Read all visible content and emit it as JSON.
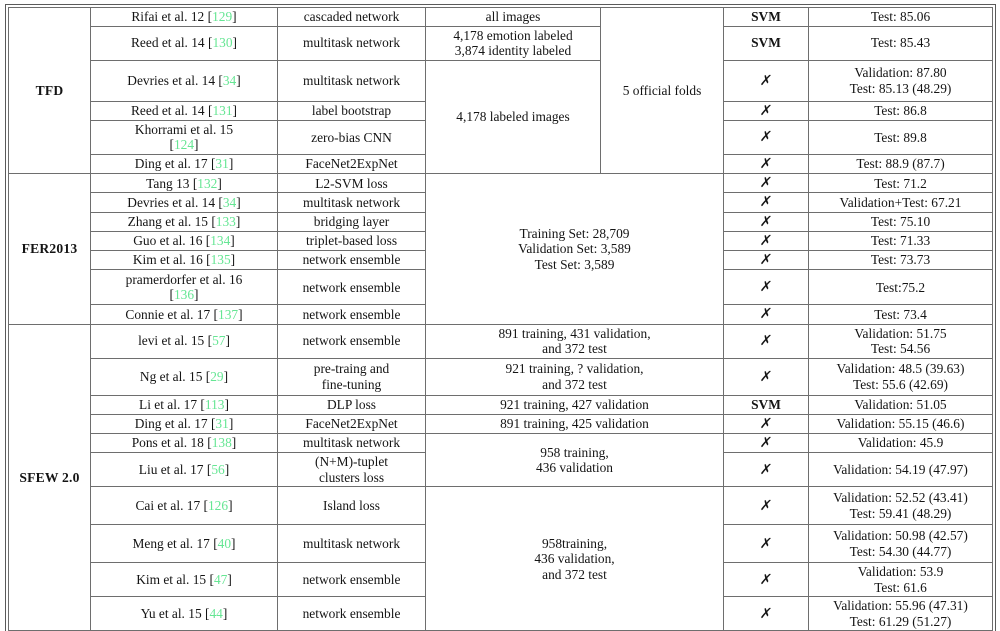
{
  "table": {
    "reference_color": "#66e694",
    "grid_color": "#6e6e6e",
    "text_color": "#141414",
    "cross_glyph": "✗",
    "sections": [
      {
        "dataset": "TFD",
        "rows": [
          {
            "method": "Rifai et al. 12",
            "ref": "129",
            "network": "cascaded network",
            "data": "all images",
            "protocol": "5 official folds",
            "classifier": "SVM",
            "performance": [
              "Test: 85.06"
            ]
          },
          {
            "method": "Reed et al. 14",
            "ref": "130",
            "network": "multitask network",
            "data": "4,178 emotion labeled\n3,874 identity labeled",
            "data_lines": [
              "4,178 emotion labeled",
              "3,874 identity labeled"
            ],
            "classifier": "SVM",
            "performance": [
              "Test: 85.43"
            ]
          },
          {
            "method": "Devries et al. 14",
            "ref": "34",
            "network": "multitask network",
            "classifier": "✗",
            "performance": [
              "Validation: 87.80",
              "Test: 85.13 (48.29)"
            ]
          },
          {
            "method": "Reed et al. 14",
            "ref": "131",
            "network": "label bootstrap",
            "data": "4,178 labeled images",
            "classifier": "✗",
            "performance": [
              "Test: 86.8"
            ]
          },
          {
            "method": "Khorrami et al. 15",
            "ref": "124",
            "method_two_line": true,
            "network": "zero-bias CNN",
            "classifier": "✗",
            "performance": [
              "Test: 89.8"
            ]
          },
          {
            "method": "Ding et al. 17",
            "ref": "31",
            "network": "FaceNet2ExpNet",
            "classifier": "✗",
            "performance": [
              "Test: 88.9 (87.7)"
            ]
          }
        ],
        "merged": {
          "data_all_images": "all images",
          "data_emotion": [
            "4,178 emotion labeled",
            "3,874 identity labeled"
          ],
          "data_labeled": "4,178 labeled images",
          "protocol": "5 official folds"
        }
      },
      {
        "dataset": "FER2013",
        "merged_data": [
          "Training Set: 28,709",
          "Validation Set: 3,589",
          "Test Set: 3,589"
        ],
        "rows": [
          {
            "method": "Tang 13",
            "ref": "132",
            "network": "L2-SVM loss",
            "classifier": "✗",
            "performance": [
              "Test: 71.2"
            ]
          },
          {
            "method": "Devries et al. 14",
            "ref": "34",
            "network": "multitask network",
            "classifier": "✗",
            "performance": [
              "Validation+Test: 67.21"
            ]
          },
          {
            "method": "Zhang et al. 15",
            "ref": "133",
            "network": "bridging layer",
            "classifier": "✗",
            "performance": [
              "Test: 75.10"
            ]
          },
          {
            "method": "Guo et al. 16",
            "ref": "134",
            "network": "triplet-based loss",
            "classifier": "✗",
            "performance": [
              "Test: 71.33"
            ]
          },
          {
            "method": "Kim et al. 16",
            "ref": "135",
            "network": "network ensemble",
            "classifier": "✗",
            "performance": [
              "Test: 73.73"
            ]
          },
          {
            "method": "pramerdorfer et al. 16",
            "ref": "136",
            "method_two_line": true,
            "network": "network ensemble",
            "classifier": "✗",
            "performance": [
              "Test:75.2"
            ]
          },
          {
            "method": "Connie et al. 17",
            "ref": "137",
            "network": "network ensemble",
            "classifier": "✗",
            "performance": [
              "Test: 73.4"
            ]
          }
        ]
      },
      {
        "dataset": "SFEW 2.0",
        "rows": [
          {
            "method": "levi et al. 15",
            "ref": "57",
            "network": "network ensemble",
            "data": [
              "891 training, 431 validation,",
              "and 372 test"
            ],
            "classifier": "✗",
            "performance": [
              "Validation: 51.75",
              "Test: 54.56"
            ]
          },
          {
            "method": "Ng et al. 15",
            "ref": "29",
            "network": [
              "pre-traing and",
              "fine-tuning"
            ],
            "data": [
              "921 training, ? validation,",
              "and 372 test"
            ],
            "classifier": "✗",
            "performance": [
              "Validation: 48.5 (39.63)",
              "Test: 55.6 (42.69)"
            ]
          },
          {
            "method": "Li et al. 17",
            "ref": "113",
            "network": "DLP loss",
            "data": [
              "921 training, 427 validation"
            ],
            "classifier": "SVM",
            "performance": [
              "Validation: 51.05"
            ]
          },
          {
            "method": "Ding et al. 17",
            "ref": "31",
            "network": "FaceNet2ExpNet",
            "data": [
              "891 training, 425 validation"
            ],
            "classifier": "✗",
            "performance": [
              "Validation: 55.15 (46.6)"
            ]
          },
          {
            "method": "Pons et al. 18",
            "ref": "138",
            "network": "multitask network",
            "classifier": "✗",
            "performance": [
              "Validation: 45.9"
            ]
          },
          {
            "method": "Liu et al. 17",
            "ref": "56",
            "network": [
              "(N+M)-tuplet",
              "clusters loss"
            ],
            "classifier": "✗",
            "performance": [
              "Validation: 54.19 (47.97)"
            ]
          },
          {
            "method": "Cai et al. 17",
            "ref": "126",
            "network": "Island loss",
            "classifier": "✗",
            "performance": [
              "Validation: 52.52 (43.41)",
              "Test: 59.41 (48.29)"
            ]
          },
          {
            "method": "Meng et al. 17",
            "ref": "40",
            "network": "multitask network",
            "classifier": "✗",
            "performance": [
              "Validation: 50.98 (42.57)",
              "Test: 54.30 (44.77)"
            ]
          },
          {
            "method": "Kim et al. 15",
            "ref": "47",
            "network": "network ensemble",
            "classifier": "✗",
            "performance": [
              "Validation: 53.9",
              "Test: 61.6"
            ]
          },
          {
            "method": "Yu et al. 15",
            "ref": "44",
            "network": "network ensemble",
            "classifier": "✗",
            "performance": [
              "Validation: 55.96 (47.31)",
              "Test: 61.29 (51.27)"
            ]
          }
        ],
        "merged_data_958a": [
          "958 training,",
          "436 validation"
        ],
        "merged_data_958b": [
          "958training,",
          "436 validation,",
          "and 372 test"
        ]
      }
    ]
  }
}
